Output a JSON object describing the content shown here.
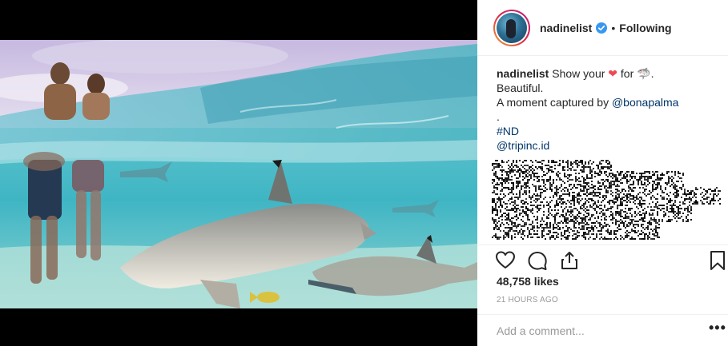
{
  "post": {
    "username": "nadinelist",
    "follow_status": "Following",
    "separator": "•",
    "verified": true
  },
  "caption": {
    "username": "nadinelist",
    "text_part1": "Show your",
    "heart_emoji": "❤",
    "text_part2": "for",
    "shark_emoji": "🦈",
    "period": ".",
    "line2": "Beautiful.",
    "line3_prefix": "A moment captured by",
    "line3_mention": "@bonapalma",
    "line4": ".",
    "hashtag": "#ND",
    "mention2": "@tripinc.id"
  },
  "actions": {
    "like_icon": "heart-icon",
    "comment_icon": "comment-icon",
    "share_icon": "share-icon",
    "save_icon": "bookmark-icon"
  },
  "likes": "48,758 likes",
  "timestamp": "21 HOURS AGO",
  "comment_box": {
    "placeholder": "Add a comment...",
    "more": "•••"
  },
  "colors": {
    "link": "#003569",
    "heart": "#ed4956",
    "verified": "#3897f0",
    "muted": "#999999",
    "border": "#efefef"
  }
}
